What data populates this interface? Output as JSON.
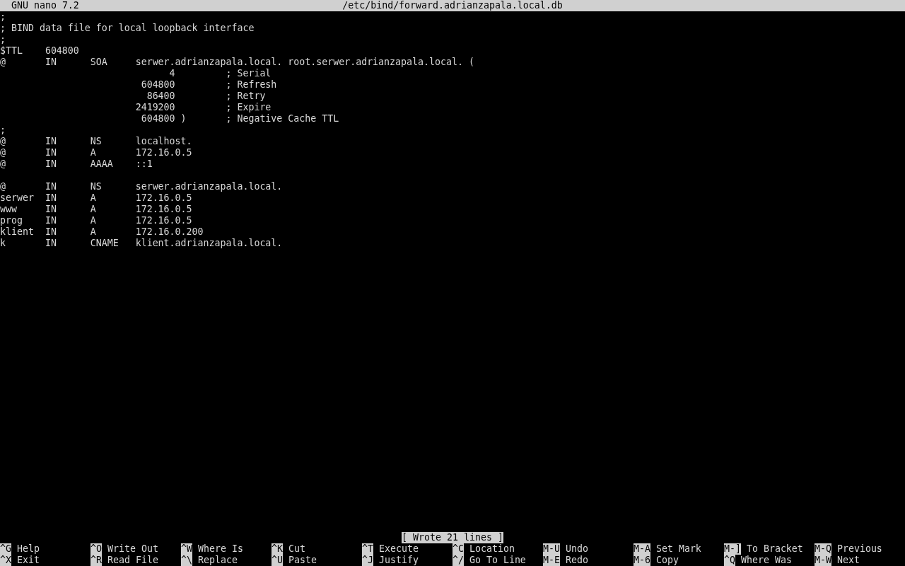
{
  "title_bar": {
    "app": "GNU nano 7.2",
    "file": "/etc/bind/forward.adrianzapala.local.db"
  },
  "lines": [
    {
      "text": ";"
    },
    {
      "text": "; BIND data file for local loopback interface"
    },
    {
      "text": ";"
    },
    {
      "text": "$TTL    604800"
    },
    {
      "text": "@       IN      SOA     serwer.adrianzapala.local. root.serwer.adrianzapala.local. ("
    },
    {
      "text": "                              4         ; Serial"
    },
    {
      "text": "                         604800         ; Refresh"
    },
    {
      "text": "                          86400         ; Retry"
    },
    {
      "text": "                        2419200         ; Expire"
    },
    {
      "text": "                         604800 )       ; Negative Cache TTL"
    },
    {
      "text": ";"
    },
    {
      "text": "@       IN      NS      localhost."
    },
    {
      "text": "@       IN      A       172.16.0.5"
    },
    {
      "text": "@       IN      AAAA    ::1"
    },
    {
      "kind": "blank"
    },
    {
      "text": "@       IN      NS      serwer.adrianzapala.local."
    },
    {
      "text": "serwer  IN      A       172.16.0.5"
    },
    {
      "text": "www     IN      A       172.16.0.5"
    },
    {
      "text": "prog    IN      A       172.16.0.5"
    },
    {
      "text": "klient  IN      A       172.16.0.200"
    },
    {
      "text": "k       IN      CNAME   klient.adrianzapala.local."
    }
  ],
  "status": "[ Wrote 21 lines ]",
  "shortcuts": [
    {
      "key": "^G",
      "label": "Help"
    },
    {
      "key": "^O",
      "label": "Write Out"
    },
    {
      "key": "^W",
      "label": "Where Is"
    },
    {
      "key": "^K",
      "label": "Cut"
    },
    {
      "key": "^T",
      "label": "Execute"
    },
    {
      "key": "^C",
      "label": "Location"
    },
    {
      "key": "M-U",
      "label": "Undo"
    },
    {
      "key": "M-A",
      "label": "Set Mark"
    },
    {
      "key": "M-]",
      "label": "To Bracket"
    },
    {
      "key": "M-Q",
      "label": "Previous"
    },
    {
      "key": "^X",
      "label": "Exit"
    },
    {
      "key": "^R",
      "label": "Read File"
    },
    {
      "key": "^\\",
      "label": "Replace"
    },
    {
      "key": "^U",
      "label": "Paste"
    },
    {
      "key": "^J",
      "label": "Justify"
    },
    {
      "key": "^/",
      "label": "Go To Line"
    },
    {
      "key": "M-E",
      "label": "Redo"
    },
    {
      "key": "M-6",
      "label": "Copy"
    },
    {
      "key": "^Q",
      "label": "Where Was"
    },
    {
      "key": "M-W",
      "label": "Next"
    }
  ]
}
